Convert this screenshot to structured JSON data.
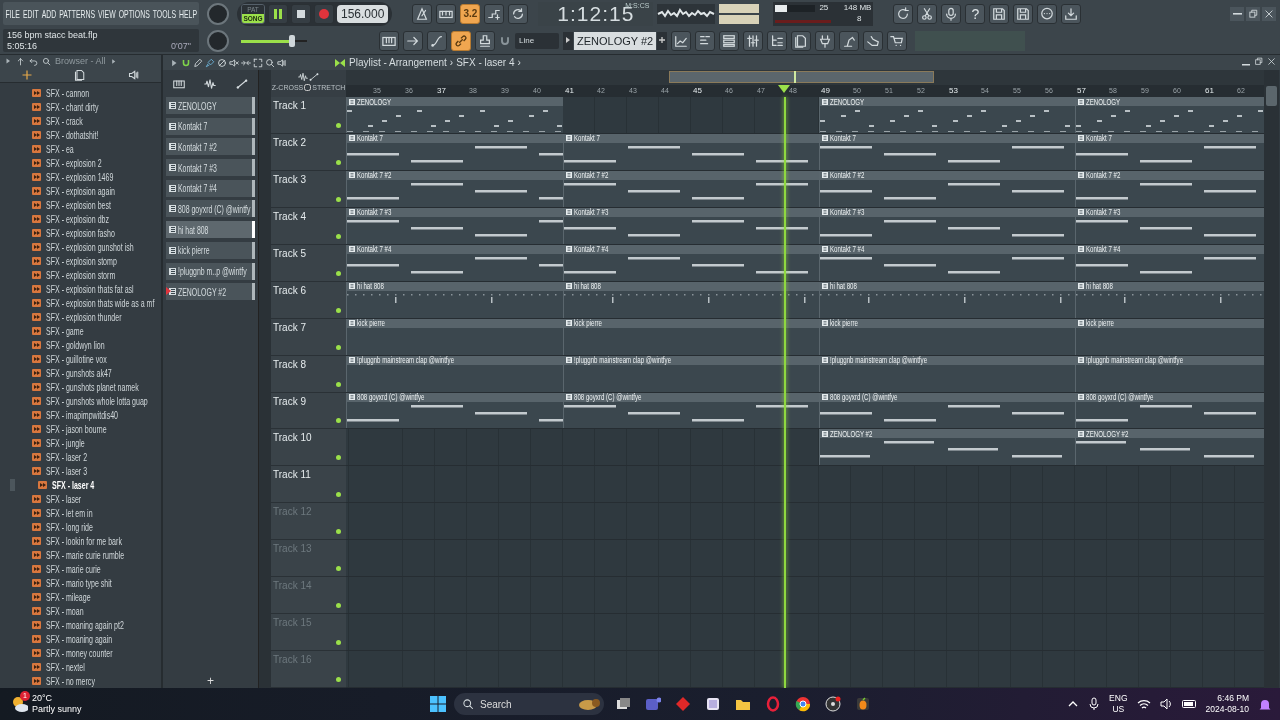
{
  "toolbar": {
    "menus": [
      "FILE",
      "EDIT",
      "ADD",
      "PATTERNS",
      "VIEW",
      "OPTIONS",
      "TOOLS",
      "HELP"
    ],
    "project": {
      "filename": "156 bpm stacc beat.flp",
      "time": "5:05:16",
      "elapsed": "0'07\""
    },
    "modes": [
      {
        "label": "PAT",
        "selected": false
      },
      {
        "label": "SONG",
        "selected": true
      }
    ],
    "playing": true,
    "tempo": "156.000",
    "clock": {
      "time": "1:12:15",
      "unit": "M:S:CS"
    },
    "cpu": {
      "level": 0.3,
      "reading": "25",
      "memory": "148 MB",
      "voices": "8"
    },
    "master_volume": {
      "level": 0.78
    },
    "record_buttons": [
      {
        "on": false
      },
      {
        "on": false
      },
      {
        "on": true,
        "label": "3.2"
      },
      {
        "on": false
      },
      {
        "on": false
      }
    ],
    "help_label": "?",
    "tool_buttons": [
      {
        "on": false
      },
      {
        "on": false
      },
      {
        "on": false
      },
      {
        "on": true
      },
      {
        "on": false
      }
    ],
    "snap": "Line",
    "pattern": "ZENOLOGY #2"
  },
  "browser": {
    "title": "Browser - All",
    "items": [
      {
        "label": "SFX - cannon",
        "selected": false
      },
      {
        "label": "SFX - chant dirty",
        "selected": false
      },
      {
        "label": "SFX - crack",
        "selected": false
      },
      {
        "label": "SFX - dothatshit!",
        "selected": false
      },
      {
        "label": "SFX - ea",
        "selected": false
      },
      {
        "label": "SFX - explosion 2",
        "selected": false
      },
      {
        "label": "SFX - explosion 1469",
        "selected": false
      },
      {
        "label": "SFX - explosion again",
        "selected": false
      },
      {
        "label": "SFX - explosion best",
        "selected": false
      },
      {
        "label": "SFX - explosion dbz",
        "selected": false
      },
      {
        "label": "SFX - explosion fasho",
        "selected": false
      },
      {
        "label": "SFX - explosion gunshot ish",
        "selected": false
      },
      {
        "label": "SFX - explosion stomp",
        "selected": false
      },
      {
        "label": "SFX - explosion storm",
        "selected": false
      },
      {
        "label": "SFX - explosion thats fat asl",
        "selected": false
      },
      {
        "label": "SFX - explosion thats wide as a mf",
        "selected": false
      },
      {
        "label": "SFX - explosion thunder",
        "selected": false
      },
      {
        "label": "SFX - game",
        "selected": false
      },
      {
        "label": "SFX - goldwyn lion",
        "selected": false
      },
      {
        "label": "SFX - guillotine vox",
        "selected": false
      },
      {
        "label": "SFX - gunshots ak47",
        "selected": false
      },
      {
        "label": "SFX - gunshots planet namek",
        "selected": false
      },
      {
        "label": "SFX - gunshots whole lotta guap",
        "selected": false
      },
      {
        "label": "SFX - imapimpwitdis40",
        "selected": false
      },
      {
        "label": "SFX - jason bourne",
        "selected": false
      },
      {
        "label": "SFX - jungle",
        "selected": false
      },
      {
        "label": "SFX - laser 2",
        "selected": false
      },
      {
        "label": "SFX - laser 3",
        "selected": false
      },
      {
        "label": "SFX - laser 4",
        "selected": true
      },
      {
        "label": "SFX - laser",
        "selected": false
      },
      {
        "label": "SFX - let em in",
        "selected": false
      },
      {
        "label": "SFX - long ride",
        "selected": false
      },
      {
        "label": "SFX - lookin for me bark",
        "selected": false
      },
      {
        "label": "SFX - marie curie rumble",
        "selected": false
      },
      {
        "label": "SFX - marie curie",
        "selected": false
      },
      {
        "label": "SFX - mario type shit",
        "selected": false
      },
      {
        "label": "SFX - mileage",
        "selected": false
      },
      {
        "label": "SFX - moan",
        "selected": false
      },
      {
        "label": "SFX - moaning again pt2",
        "selected": false
      },
      {
        "label": "SFX - moaning again",
        "selected": false
      },
      {
        "label": "SFX - money counter",
        "selected": false
      },
      {
        "label": "SFX - nextel",
        "selected": false
      },
      {
        "label": "SFX - no mercy",
        "selected": false
      }
    ]
  },
  "playlist": {
    "breadcrumb": [
      "Playlist - Arrangement",
      "›",
      "SFX - laser 4",
      "›"
    ],
    "header_options": [
      "Z-CROSS",
      "STRETCH"
    ],
    "channels": [
      {
        "name": "ZENOLOGY",
        "selected": false,
        "targeted": false
      },
      {
        "name": "Kontakt 7",
        "selected": false,
        "targeted": false
      },
      {
        "name": "Kontakt 7 #2",
        "selected": false,
        "targeted": false
      },
      {
        "name": "Kontakt 7 #3",
        "selected": false,
        "targeted": false
      },
      {
        "name": "Kontakt 7 #4",
        "selected": false,
        "targeted": false
      },
      {
        "name": "808 goyxrd (C) @wintfy",
        "selected": false,
        "targeted": false
      },
      {
        "name": "hi hat 808",
        "selected": true,
        "targeted": false
      },
      {
        "name": "kick pierre",
        "selected": false,
        "targeted": false
      },
      {
        "name": "!pluggnb m..p @wintfy",
        "selected": false,
        "targeted": false
      },
      {
        "name": "ZENOLOGY #2",
        "selected": false,
        "targeted": true
      }
    ],
    "add_label": "+",
    "ruler": [
      {
        "label": "35",
        "major": false
      },
      {
        "label": "36",
        "major": false
      },
      {
        "label": "37",
        "major": true
      },
      {
        "label": "38",
        "major": false
      },
      {
        "label": "39",
        "major": false
      },
      {
        "label": "40",
        "major": false
      },
      {
        "label": "41",
        "major": true
      },
      {
        "label": "42",
        "major": false
      },
      {
        "label": "43",
        "major": false
      },
      {
        "label": "44",
        "major": false
      },
      {
        "label": "45",
        "major": true
      },
      {
        "label": "46",
        "major": false
      },
      {
        "label": "47",
        "major": false
      },
      {
        "label": "48",
        "major": false
      },
      {
        "label": "49",
        "major": true
      },
      {
        "label": "50",
        "major": false
      },
      {
        "label": "51",
        "major": false
      },
      {
        "label": "52",
        "major": false
      },
      {
        "label": "53",
        "major": true
      },
      {
        "label": "54",
        "major": false
      },
      {
        "label": "55",
        "major": false
      },
      {
        "label": "56",
        "major": false
      },
      {
        "label": "57",
        "major": true
      },
      {
        "label": "58",
        "major": false
      },
      {
        "label": "59",
        "major": false
      },
      {
        "label": "60",
        "major": false
      },
      {
        "label": "61",
        "major": true
      },
      {
        "label": "62",
        "major": false
      }
    ],
    "tracks": [
      {
        "name": "Track 1",
        "dimmed": false,
        "enabled": true,
        "clips": [
          {
            "kind": "clip",
            "label": "ZENOLOGY"
          },
          {
            "kind": "empty"
          },
          {
            "kind": "clip",
            "label": "ZENOLOGY"
          },
          {
            "kind": "clip",
            "label": "ZENOLOGY"
          }
        ]
      },
      {
        "name": "Track 2",
        "dimmed": false,
        "enabled": true,
        "clips": [
          {
            "kind": "clip",
            "label": "Kontakt 7"
          },
          {
            "kind": "clip",
            "label": "Kontakt 7"
          },
          {
            "kind": "clip",
            "label": "Kontakt 7"
          },
          {
            "kind": "clip",
            "label": "Kontakt 7"
          }
        ]
      },
      {
        "name": "Track 3",
        "dimmed": false,
        "enabled": true,
        "clips": [
          {
            "kind": "clip",
            "label": "Kontakt 7 #2"
          },
          {
            "kind": "clip",
            "label": "Kontakt 7 #2"
          },
          {
            "kind": "clip",
            "label": "Kontakt 7 #2"
          },
          {
            "kind": "clip",
            "label": "Kontakt 7 #2"
          }
        ]
      },
      {
        "name": "Track 4",
        "dimmed": false,
        "enabled": true,
        "clips": [
          {
            "kind": "clip",
            "label": "Kontakt 7 #3"
          },
          {
            "kind": "clip",
            "label": "Kontakt 7 #3"
          },
          {
            "kind": "clip",
            "label": "Kontakt 7 #3"
          },
          {
            "kind": "clip",
            "label": "Kontakt 7 #3"
          }
        ]
      },
      {
        "name": "Track 5",
        "dimmed": false,
        "enabled": true,
        "clips": [
          {
            "kind": "clip",
            "label": "Kontakt 7 #4"
          },
          {
            "kind": "clip",
            "label": "Kontakt 7 #4"
          },
          {
            "kind": "clip",
            "label": "Kontakt 7 #4"
          },
          {
            "kind": "clip",
            "label": "Kontakt 7 #4"
          }
        ]
      },
      {
        "name": "Track 6",
        "dimmed": false,
        "enabled": true,
        "clips": [
          {
            "kind": "clip",
            "label": "hi hat 808"
          },
          {
            "kind": "clip",
            "label": "hi hat 808"
          },
          {
            "kind": "clip",
            "label": "hi hat 808"
          },
          {
            "kind": "clip",
            "label": "hi hat 808"
          }
        ]
      },
      {
        "name": "Track 7",
        "dimmed": false,
        "enabled": true,
        "clips": [
          {
            "kind": "clip",
            "label": "kick pierre"
          },
          {
            "kind": "clip",
            "label": "kick pierre"
          },
          {
            "kind": "clip",
            "label": "kick pierre"
          },
          {
            "kind": "clip",
            "label": "kick pierre"
          }
        ]
      },
      {
        "name": "Track 8",
        "dimmed": false,
        "enabled": true,
        "clips": [
          {
            "kind": "clip",
            "label": "!pluggnb mainstream clap @wintfye"
          },
          {
            "kind": "clip",
            "label": "!pluggnb mainstream clap @wintfye"
          },
          {
            "kind": "clip",
            "label": "!pluggnb mainstream clap @wintfye"
          },
          {
            "kind": "clip",
            "label": "!pluggnb mainstream clap @wintfye"
          }
        ]
      },
      {
        "name": "Track 9",
        "dimmed": false,
        "enabled": true,
        "clips": [
          {
            "kind": "clip",
            "label": "808 goyxrd (C) @wintfye"
          },
          {
            "kind": "clip",
            "label": "808 goyxrd (C) @wintfye"
          },
          {
            "kind": "clip",
            "label": "808 goyxrd (C) @wintfye"
          },
          {
            "kind": "clip",
            "label": "808 goyxrd (C) @wintfye"
          }
        ]
      },
      {
        "name": "Track 10",
        "dimmed": false,
        "enabled": true,
        "clips": [
          {
            "kind": "empty"
          },
          {
            "kind": "empty"
          },
          {
            "kind": "clip",
            "label": "ZENOLOGY #2"
          },
          {
            "kind": "clip",
            "label": "ZENOLOGY #2"
          }
        ]
      },
      {
        "name": "Track 11",
        "dimmed": false,
        "enabled": true
      },
      {
        "name": "Track 12",
        "dimmed": true,
        "enabled": true
      },
      {
        "name": "Track 13",
        "dimmed": true,
        "enabled": true
      },
      {
        "name": "Track 14",
        "dimmed": true,
        "enabled": true
      },
      {
        "name": "Track 15",
        "dimmed": true,
        "enabled": true
      },
      {
        "name": "Track 16",
        "dimmed": true,
        "enabled": true
      }
    ]
  },
  "taskbar": {
    "weather": {
      "badge": "1",
      "temperature": "20°C",
      "condition": "Partly sunny"
    },
    "search": {
      "placeholder": "Search"
    },
    "language": [
      "ENG",
      "US"
    ],
    "clock": {
      "time": "6:46 PM",
      "date": "2024-08-10"
    }
  }
}
